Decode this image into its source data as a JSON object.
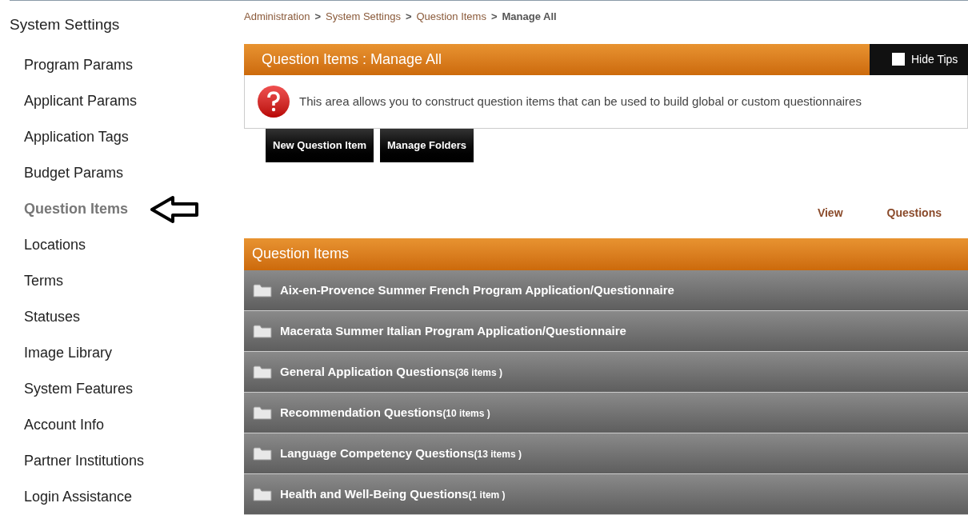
{
  "sidebar": {
    "title": "System Settings",
    "items": [
      {
        "label": "Program Params",
        "selected": false
      },
      {
        "label": "Applicant Params",
        "selected": false
      },
      {
        "label": "Application Tags",
        "selected": false
      },
      {
        "label": "Budget Params",
        "selected": false
      },
      {
        "label": "Question Items",
        "selected": true
      },
      {
        "label": "Locations",
        "selected": false
      },
      {
        "label": "Terms",
        "selected": false
      },
      {
        "label": "Statuses",
        "selected": false
      },
      {
        "label": "Image Library",
        "selected": false
      },
      {
        "label": "System Features",
        "selected": false
      },
      {
        "label": "Account Info",
        "selected": false
      },
      {
        "label": "Partner Institutions",
        "selected": false
      },
      {
        "label": "Login Assistance",
        "selected": false
      }
    ]
  },
  "breadcrumb": [
    {
      "label": "Administration",
      "current": false
    },
    {
      "label": "System Settings",
      "current": false
    },
    {
      "label": "Question Items",
      "current": false
    },
    {
      "label": "Manage All",
      "current": true
    }
  ],
  "breadcrumb_separator": ">",
  "page_header": {
    "title": "Question Items : Manage All",
    "hide_tips": {
      "label": "Hide Tips",
      "checked": false
    }
  },
  "tip": "This area allows you to construct question items that can be used to build global or custom questionnaires",
  "buttons": [
    "New Question Item",
    "Manage Folders"
  ],
  "columns": [
    "View",
    "Questions"
  ],
  "folders": {
    "title": "Question Items",
    "rows": [
      {
        "name": "Aix-en-Provence Summer French Program Application/Questionnaire"
      },
      {
        "name": "Macerata Summer Italian Program Application/Questionnaire"
      },
      {
        "name": "General Application Questions",
        "count": "(36 items )"
      },
      {
        "name": "Recommendation Questions",
        "count": "(10 items )"
      },
      {
        "name": "Language Competency Questions",
        "count": "(13 items )"
      },
      {
        "name": "Health and Well-Being Questions",
        "count": "(1 item )"
      }
    ]
  }
}
